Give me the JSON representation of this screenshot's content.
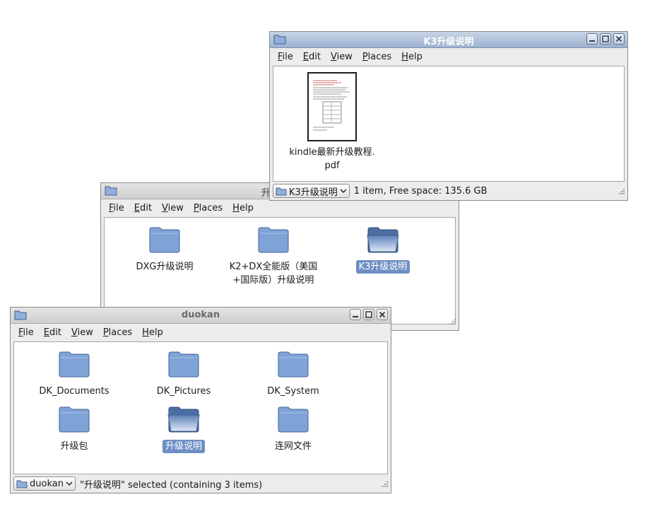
{
  "menus": [
    "File",
    "Edit",
    "View",
    "Places",
    "Help"
  ],
  "windows": {
    "k3": {
      "title": "K3升级说明",
      "location": "K3升级说明",
      "status": "1 item, Free space: 135.6 GB",
      "file": {
        "line1": "kindle最新升级教程.",
        "line2": "pdf"
      }
    },
    "upgrade": {
      "title": "升级说明",
      "items": [
        {
          "lines": [
            "DXG升级说明"
          ]
        },
        {
          "lines": [
            "K2+DX全能版（美国",
            "+国际版）升级说明"
          ]
        },
        {
          "lines": [
            "K3升级说明"
          ]
        }
      ]
    },
    "duokan": {
      "title": "duokan",
      "location": "duokan",
      "status": "\"升级说明\" selected (containing 3 items)",
      "items": [
        {
          "label": "DK_Documents"
        },
        {
          "label": "DK_Pictures"
        },
        {
          "label": "DK_System"
        },
        {
          "label": "升级包"
        },
        {
          "label": "升级说明"
        },
        {
          "label": "连网文件"
        }
      ]
    }
  },
  "icons": {
    "folder": "folder-icon",
    "folder_open": "folder-open-icon",
    "pdf": "pdf-document-icon",
    "minimize": "minimize-icon",
    "maximize": "maximize-icon",
    "close": "close-icon"
  },
  "colors": {
    "titlebar_active": "#9eb3d0",
    "titlebar_inactive": "#cfcfcf",
    "selection": "#6e8fc3",
    "folder_fill": "#7fa3d6"
  }
}
